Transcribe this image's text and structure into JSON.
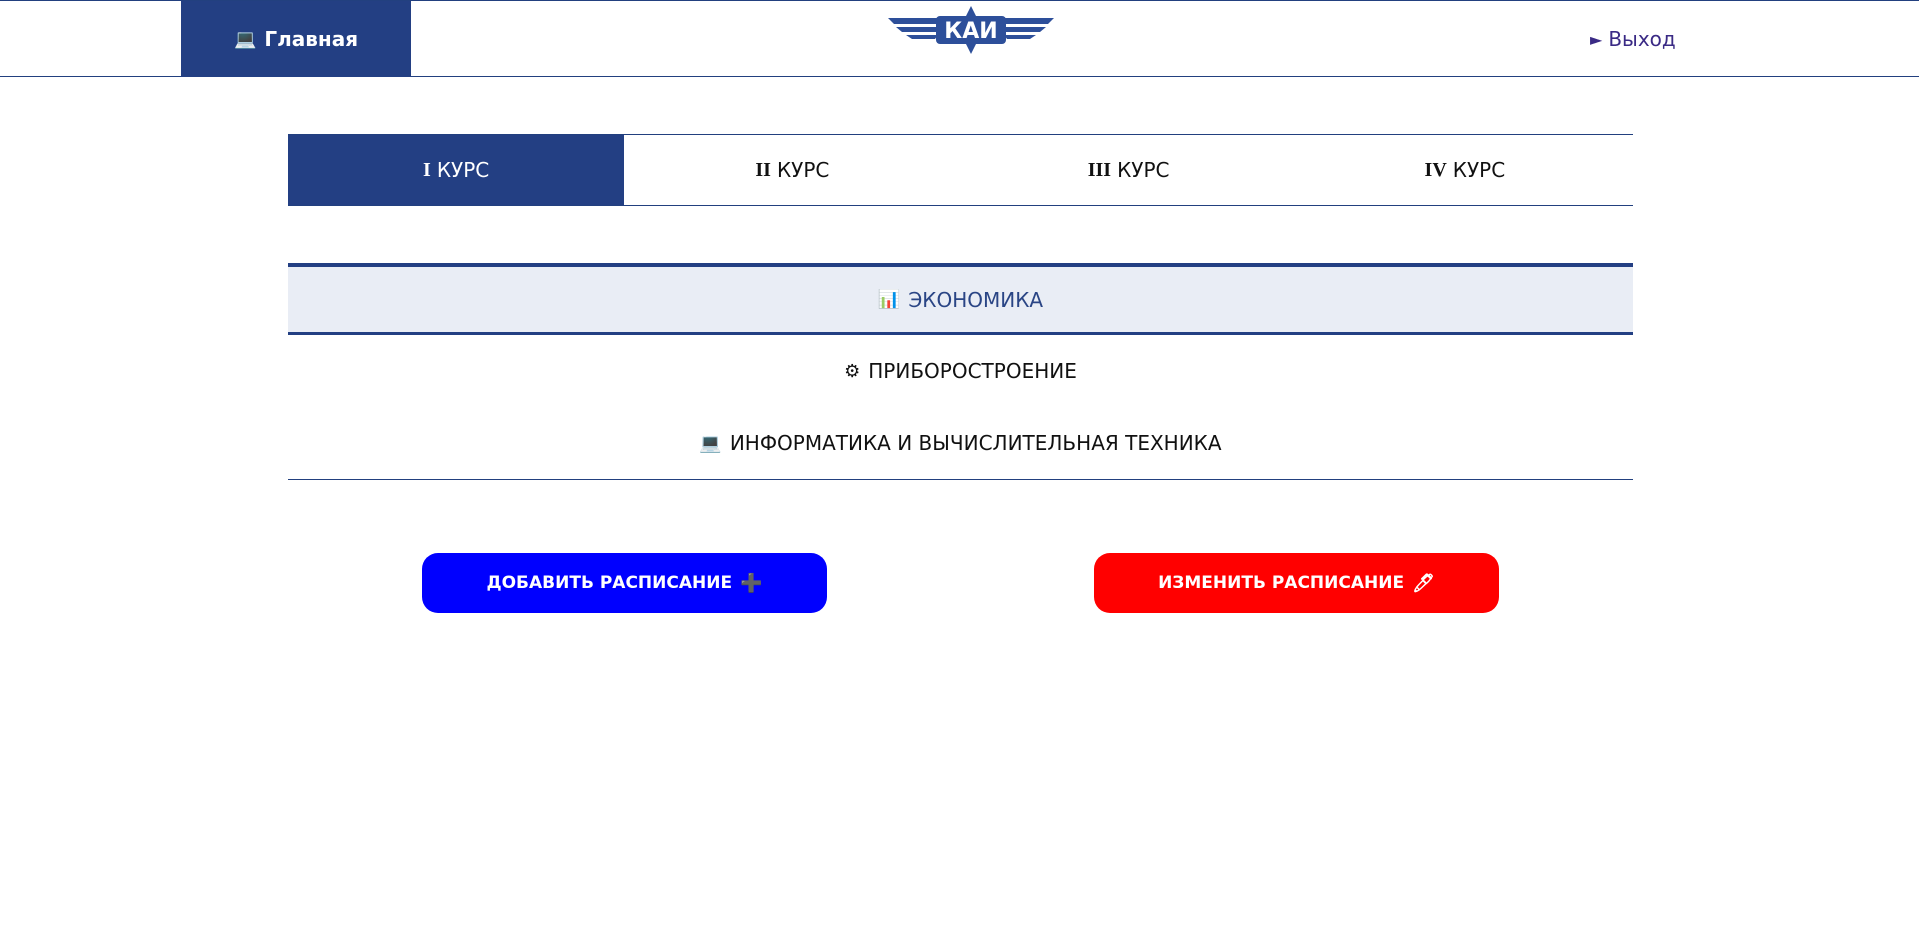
{
  "header": {
    "home_icon": "laptop-icon",
    "home_icon_glyph": "💻",
    "home_label": "Главная",
    "logo_text": "КАИ",
    "logout_icon": "play-arrow-icon",
    "logout_icon_glyph": "►",
    "logout_label": "Выход"
  },
  "tabs": [
    {
      "roman": "I",
      "label": "КУРС",
      "active": true
    },
    {
      "roman": "II",
      "label": "КУРС",
      "active": false
    },
    {
      "roman": "III",
      "label": "КУРС",
      "active": false
    },
    {
      "roman": "IV",
      "label": "КУРС",
      "active": false
    }
  ],
  "departments": [
    {
      "icon": "bar-chart-icon",
      "glyph": "📊",
      "label": "ЭКОНОМИКА",
      "active": true
    },
    {
      "icon": "gear-icon",
      "glyph": "⚙",
      "label": "ПРИБОРОСТРОЕНИЕ",
      "active": false
    },
    {
      "icon": "laptop-icon",
      "glyph": "💻",
      "label": "ИНФОРМАТИКА И ВЫЧИСЛИТЕЛЬНАЯ ТЕХНИКА",
      "active": false
    }
  ],
  "actions": {
    "add_label": "ДОБАВИТЬ РАСПИСАНИЕ",
    "add_icon": "plus-icon",
    "add_glyph": "➕",
    "edit_label": "ИЗМЕНИТЬ РАСПИСАНИЕ",
    "edit_icon": "pencil-icon",
    "edit_glyph": "🖊"
  },
  "colors": {
    "primary": "#233f83",
    "add_button": "#0000ff",
    "edit_button": "#ff0000",
    "active_dept_bg": "#e9edf5"
  }
}
